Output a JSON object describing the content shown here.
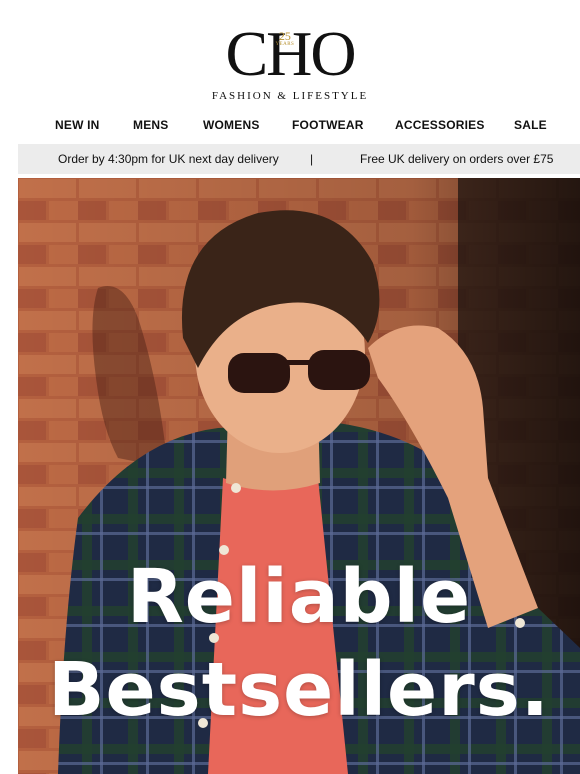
{
  "brand": {
    "logo_text": "CHO",
    "badge_number": "25",
    "badge_word": "YEARS",
    "tagline": "FASHION & LIFESTYLE"
  },
  "nav": {
    "items": [
      {
        "label": "NEW IN"
      },
      {
        "label": "MENS"
      },
      {
        "label": "WOMENS"
      },
      {
        "label": "FOOTWEAR"
      },
      {
        "label": "ACCESSORIES"
      },
      {
        "label": "SALE"
      }
    ]
  },
  "delivery_bar": {
    "left_text": "Order by 4:30pm for UK next day delivery",
    "separator": "|",
    "right_text": "Free UK delivery on orders over £75"
  },
  "hero": {
    "line1": "Reliable",
    "line2": "Bestsellers.",
    "image": "man-in-sunglasses-photo"
  },
  "colors": {
    "accent_gold": "#b8912f",
    "bar_background": "#ececec",
    "brick": "#a0533a"
  }
}
